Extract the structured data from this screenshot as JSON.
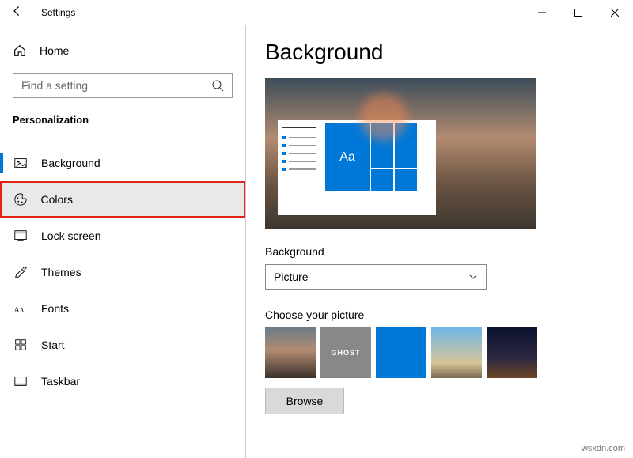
{
  "window": {
    "title": "Settings"
  },
  "sidebar": {
    "home_label": "Home",
    "search_placeholder": "Find a setting",
    "section_label": "Personalization",
    "items": [
      {
        "label": "Background"
      },
      {
        "label": "Colors"
      },
      {
        "label": "Lock screen"
      },
      {
        "label": "Themes"
      },
      {
        "label": "Fonts"
      },
      {
        "label": "Start"
      },
      {
        "label": "Taskbar"
      }
    ]
  },
  "main": {
    "page_title": "Background",
    "preview_tile_label": "Aa",
    "background_field_label": "Background",
    "background_select_value": "Picture",
    "choose_picture_label": "Choose your picture",
    "thumb2_text": "GHOST",
    "browse_label": "Browse"
  },
  "watermark": "wsxdn.com"
}
